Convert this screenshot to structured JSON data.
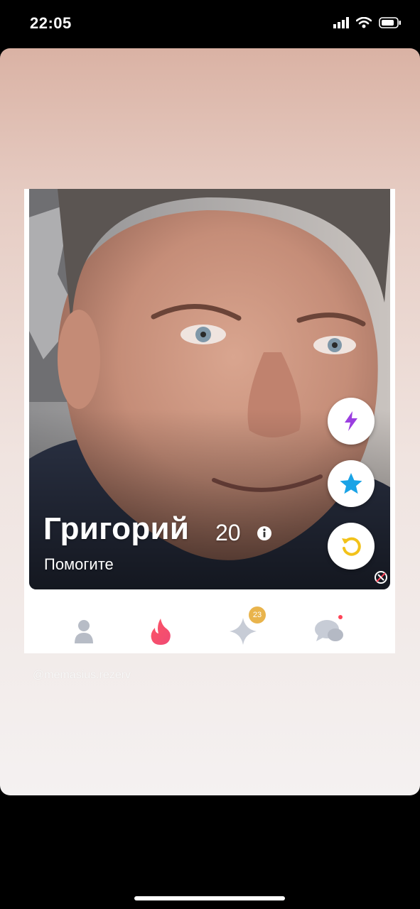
{
  "status_bar": {
    "time": "22:05",
    "icons": [
      "signal-bars-icon",
      "wifi-icon",
      "battery-icon"
    ]
  },
  "profile": {
    "name": "Григорий",
    "age": "20",
    "bio": "Помогите"
  },
  "actions": [
    {
      "icon": "boost-lightning-icon",
      "color": "#9b3fe0"
    },
    {
      "icon": "super-like-star-icon",
      "color": "#1aa3e6"
    },
    {
      "icon": "rewind-icon",
      "color": "#f2c21a"
    }
  ],
  "tab_bar": {
    "tabs": [
      "profile-icon",
      "flame-icon",
      "sparkle-icon",
      "chat-icon"
    ],
    "sparkle_badge": "23"
  },
  "watermark": "@memasius.rezerv",
  "colors": {
    "brand": "#fd3c5f",
    "accent_gold": "#e9b44c"
  }
}
